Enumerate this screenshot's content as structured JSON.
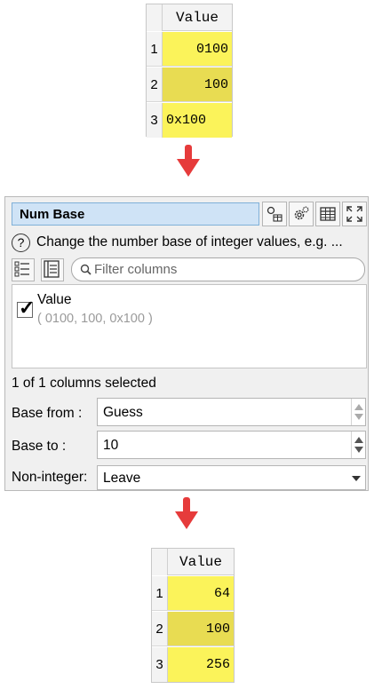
{
  "input_table": {
    "column_header": "Value",
    "rows": [
      {
        "num": "1",
        "value": "0100"
      },
      {
        "num": "2",
        "value": "100"
      },
      {
        "num": "3",
        "value": "0x100"
      }
    ]
  },
  "panel": {
    "title": "Num Base",
    "toolbar_icons": [
      "column-settings-icon",
      "gear-icon",
      "table-icon",
      "maximize-icon"
    ],
    "help_icon": "?",
    "help_text": "Change the number base of integer values, e.g. ...",
    "filter_placeholder": "Filter columns",
    "columns": [
      {
        "name": "Value",
        "sample": "( 0100, 100, 0x100 )",
        "checked": true
      }
    ],
    "check_mark": "✓",
    "selection_status": "1 of 1 columns selected",
    "base_from": {
      "label": "Base from :",
      "value": "Guess"
    },
    "base_to": {
      "label": "Base to :",
      "value": "10"
    },
    "non_integer": {
      "label": "Non-integer:",
      "value": "Leave"
    }
  },
  "output_table": {
    "column_header": "Value",
    "rows": [
      {
        "num": "1",
        "value": "64"
      },
      {
        "num": "2",
        "value": "100"
      },
      {
        "num": "3",
        "value": "256"
      }
    ]
  },
  "colors": {
    "arrow": "#e63b3b",
    "cell_yellow": "#fbf35a",
    "cell_yellow_alt": "#e8dc52",
    "title_bg": "#cfe3f6"
  }
}
